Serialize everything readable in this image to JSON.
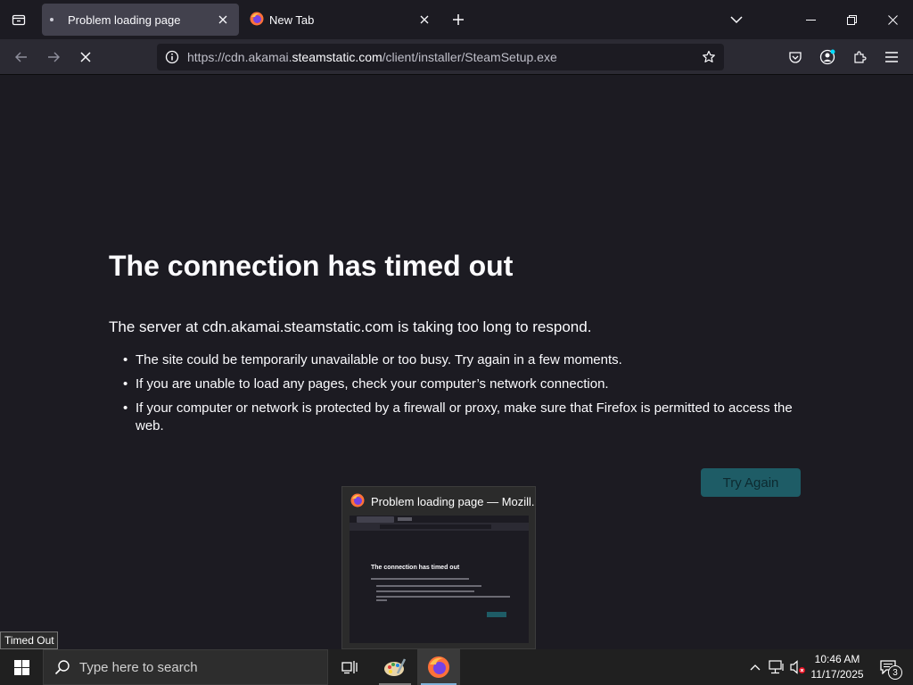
{
  "browser": {
    "tabs": [
      {
        "title": "Problem loading page",
        "active": true
      },
      {
        "title": "New Tab",
        "active": false
      }
    ],
    "url": {
      "prefix": "https://cdn.akamai.",
      "host": "steamstatic.com",
      "path": "/client/installer/SteamSetup.exe"
    }
  },
  "error": {
    "title": "The connection has timed out",
    "description": "The server at cdn.akamai.steamstatic.com is taking too long to respond.",
    "items": [
      "The site could be temporarily unavailable or too busy. Try again in a few moments.",
      "If you are unable to load any pages, check your computer’s network connection.",
      "If your computer or network is protected by a firewall or proxy, make sure that Firefox is permitted to access the web."
    ],
    "button": "Try Again"
  },
  "preview": {
    "title": "Problem loading page — Mozill...",
    "thumb_title": "The connection has timed out"
  },
  "tooltip": "Timed Out",
  "taskbar": {
    "search_placeholder": "Type here to search",
    "time": "10:46 AM",
    "date": "11/17/2025",
    "notification_count": "3"
  },
  "colors": {
    "page_bg": "#1c1b22",
    "toolbar_bg": "#2b2a33",
    "accent_button": "#1e5c66",
    "taskbar_bg": "#202020"
  }
}
